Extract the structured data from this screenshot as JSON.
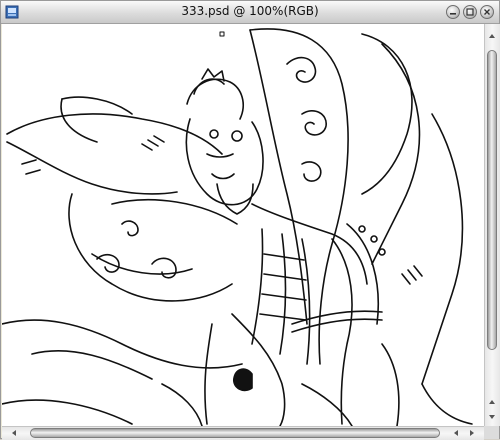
{
  "window": {
    "title": "333.psd @ 100%(RGB)"
  },
  "icons": {
    "app": "photoshop-document-icon",
    "minimize": "minimize-icon",
    "zoom": "zoom-icon",
    "close": "close-icon"
  },
  "canvas": {
    "content": "line-art-illustration-armored-warrior",
    "background": "#ffffff"
  }
}
